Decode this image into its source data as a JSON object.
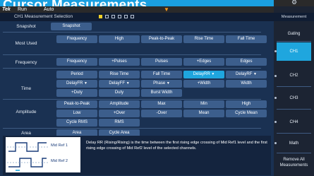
{
  "header": {
    "title": "Cursor Measurements"
  },
  "statusbar": {
    "logo": "Tek",
    "run": "Run",
    "auto": "Auto"
  },
  "window": {
    "title": "CH1 Measurement Selection"
  },
  "rows": {
    "snapshot": "Snapshot",
    "most_used": "Most Used",
    "frequency": "Frequency",
    "time": "Time",
    "amplitude": "Amplitude",
    "area": "Area"
  },
  "buttons": {
    "snapshot": "Snapshot",
    "mu_frequency": "Frequency",
    "mu_high": "High",
    "mu_peak": "Peak-to-Peak",
    "mu_rise": "Rise Time",
    "mu_fall": "Fall Time",
    "fq_frequency": "Frequency",
    "fq_pos_pulses": "+Pulses",
    "fq_pulses": "Pulses",
    "fq_pos_edges": "+Edges",
    "fq_edges": "Edges",
    "t_period": "Period",
    "t_rise": "Rise Time",
    "t_fall": "Fall Time",
    "t_delay_rr": "DelayRR",
    "t_delay_rf": "DelayRF",
    "t_delay_fr": "DelayFR",
    "t_delay_ff": "DelayFF",
    "t_phase": "Phase",
    "t_pos_width": "+Width",
    "t_width": "Width",
    "t_pos_duty": "+Duty",
    "t_duty": "Duty",
    "t_burst": "Burst Width",
    "a_peak": "Peak-to-Peak",
    "a_amp": "Amplitude",
    "a_max": "Max",
    "a_min": "Min",
    "a_high": "High",
    "a_low": "Low",
    "a_pos_over": "+Over",
    "a_neg_over": "-Over",
    "a_mean": "Mean",
    "a_cyc_mean": "Cycle Mean",
    "a_cyc_rms": "Cycle RMS",
    "a_rms": "RMS",
    "ar_area": "Area",
    "ar_cyc_area": "Cycle Area"
  },
  "description": "Delay RR (Rising/Rising) is the time between the first rising edge crossing of Mid Ref1 level and the first rising edge crossing of Mid Ref2 level of the selected channels.",
  "diagram": {
    "ref1": "Mid Ref 1",
    "ref2": "Mid Ref 2"
  },
  "side_panel": {
    "title": "Measurement",
    "gating": "Gating",
    "ch1": "CH1",
    "ch2": "CH2",
    "ch3": "CH3",
    "ch4": "CH4",
    "math": "Math",
    "remove_all": "Remove All Measurements"
  },
  "colors": {
    "accent": "#1fa6de",
    "banner": "#1a9fe0",
    "screen": "#1a3152",
    "button": "#3c5e8c",
    "trigger": "#ff9a1f"
  }
}
